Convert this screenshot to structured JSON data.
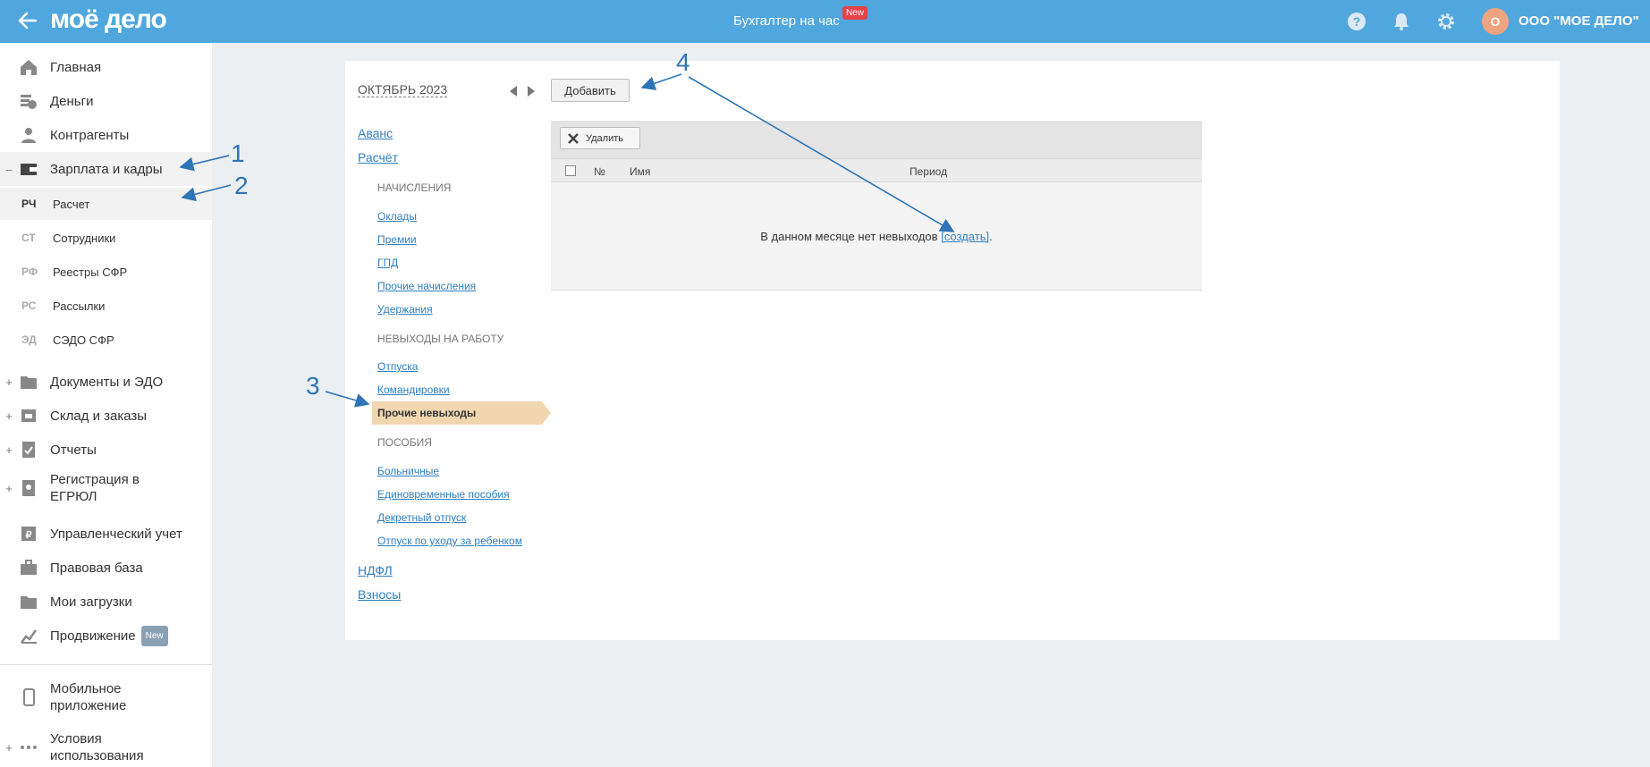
{
  "header": {
    "logo": "моё дело",
    "center_title": "Бухгалтер на час",
    "center_badge": "New",
    "avatar_letter": "О",
    "org_name": "ООО \"МОЕ ДЕЛО\""
  },
  "sidebar": {
    "items": [
      {
        "label": "Главная",
        "icon": "home-icon"
      },
      {
        "label": "Деньги",
        "icon": "money-icon"
      },
      {
        "label": "Контрагенты",
        "icon": "contractors-icon"
      },
      {
        "label": "Зарплата и кадры",
        "icon": "wallet-icon",
        "expander": "–"
      },
      {
        "label": "Документы и ЭДО",
        "icon": "folder-icon",
        "expander": "+"
      },
      {
        "label": "Склад и заказы",
        "icon": "warehouse-icon",
        "expander": "+"
      },
      {
        "label": "Отчеты",
        "icon": "reports-icon",
        "expander": "+"
      },
      {
        "label": "Регистрация в ЕГРЮЛ",
        "icon": "registration-icon",
        "expander": "+"
      },
      {
        "label": "Управленческий учет",
        "icon": "management-icon"
      },
      {
        "label": "Правовая база",
        "icon": "briefcase-icon"
      },
      {
        "label": "Мои загрузки",
        "icon": "downloads-icon"
      },
      {
        "label": "Продвижение",
        "icon": "promotion-icon",
        "badge": "New"
      },
      {
        "label": "Мобильное приложение",
        "icon": "mobile-icon"
      },
      {
        "label": "Условия использования",
        "icon": "more-icon",
        "expander": "+"
      }
    ],
    "sub_items": [
      {
        "abbr": "РЧ",
        "label": "Расчет"
      },
      {
        "abbr": "СТ",
        "label": "Сотрудники"
      },
      {
        "abbr": "РФ",
        "label": "Реестры СФР"
      },
      {
        "abbr": "РС",
        "label": "Рассылки"
      },
      {
        "abbr": "ЭД",
        "label": "СЭДО СФР"
      }
    ]
  },
  "main": {
    "month": "ОКТЯБРЬ 2023",
    "add_button": "Добавить",
    "menu": {
      "avans": "Аванс",
      "raschet": "Расчёт",
      "accruals_header": "НАЧИСЛЕНИЯ",
      "accruals": [
        "Оклады",
        "Премии",
        "ГПД",
        "Прочие начисления",
        "Удержания"
      ],
      "absences_header": "НЕВЫХОДЫ НА РАБОТУ",
      "absences": [
        "Отпуска",
        "Командировки"
      ],
      "active": "Прочие невыходы",
      "benefits_header": "ПОСОБИЯ",
      "benefits": [
        "Больничные",
        "Единовременные пособия",
        "Декретный отпуск",
        "Отпуск по уходу за ребенком"
      ],
      "ndfl": "НДФЛ",
      "vznosy": "Взносы"
    },
    "table": {
      "delete_button": "Удалить",
      "columns": [
        "№",
        "Имя",
        "Период"
      ],
      "empty_text": "В данном месяце нет невыходов",
      "create_link": "[создать]",
      "empty_suffix": "."
    }
  },
  "annotations": [
    "1",
    "2",
    "3",
    "4"
  ]
}
